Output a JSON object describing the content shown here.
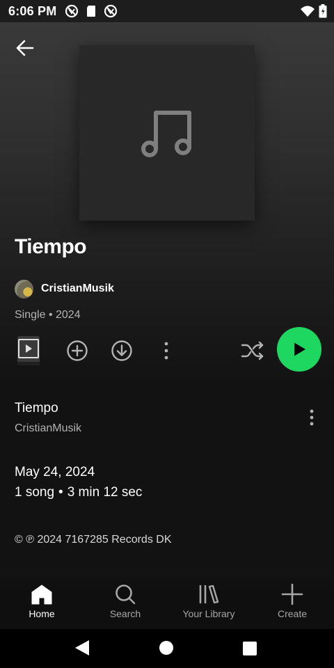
{
  "status_bar": {
    "time": "6:06 PM",
    "left_icons": [
      "vpn-icon",
      "sd-card-icon",
      "vpn-icon"
    ],
    "right_icons": [
      "wifi-icon",
      "battery-icon"
    ]
  },
  "header": {
    "back_icon": "arrow-left-icon"
  },
  "album": {
    "cover_icon": "music-note-icon",
    "title": "Tiempo",
    "artist": "CristianMusik",
    "type": "Single",
    "separator": "•",
    "year": "2024"
  },
  "actions": {
    "icons": [
      "preview-icon",
      "add-circle-icon",
      "download-icon",
      "more-vertical-icon",
      "shuffle-icon",
      "play-icon"
    ],
    "accent_color": "#1ed760"
  },
  "tracks": [
    {
      "title": "Tiempo",
      "artist": "CristianMusik"
    }
  ],
  "release": {
    "date": "May 24, 2024",
    "song_count": "1 song",
    "separator": "•",
    "duration": "3 min 12 sec"
  },
  "copyright": "© ℗ 2024 7167285 Records DK",
  "bottom_nav": {
    "items": [
      {
        "label": "Home",
        "icon": "home-icon",
        "active": true
      },
      {
        "label": "Search",
        "icon": "search-icon",
        "active": false
      },
      {
        "label": "Your Library",
        "icon": "library-icon",
        "active": false
      },
      {
        "label": "Create",
        "icon": "plus-icon",
        "active": false
      }
    ]
  },
  "system_nav": {
    "icons": [
      "back-triangle-icon",
      "home-circle-icon",
      "recents-square-icon"
    ]
  }
}
